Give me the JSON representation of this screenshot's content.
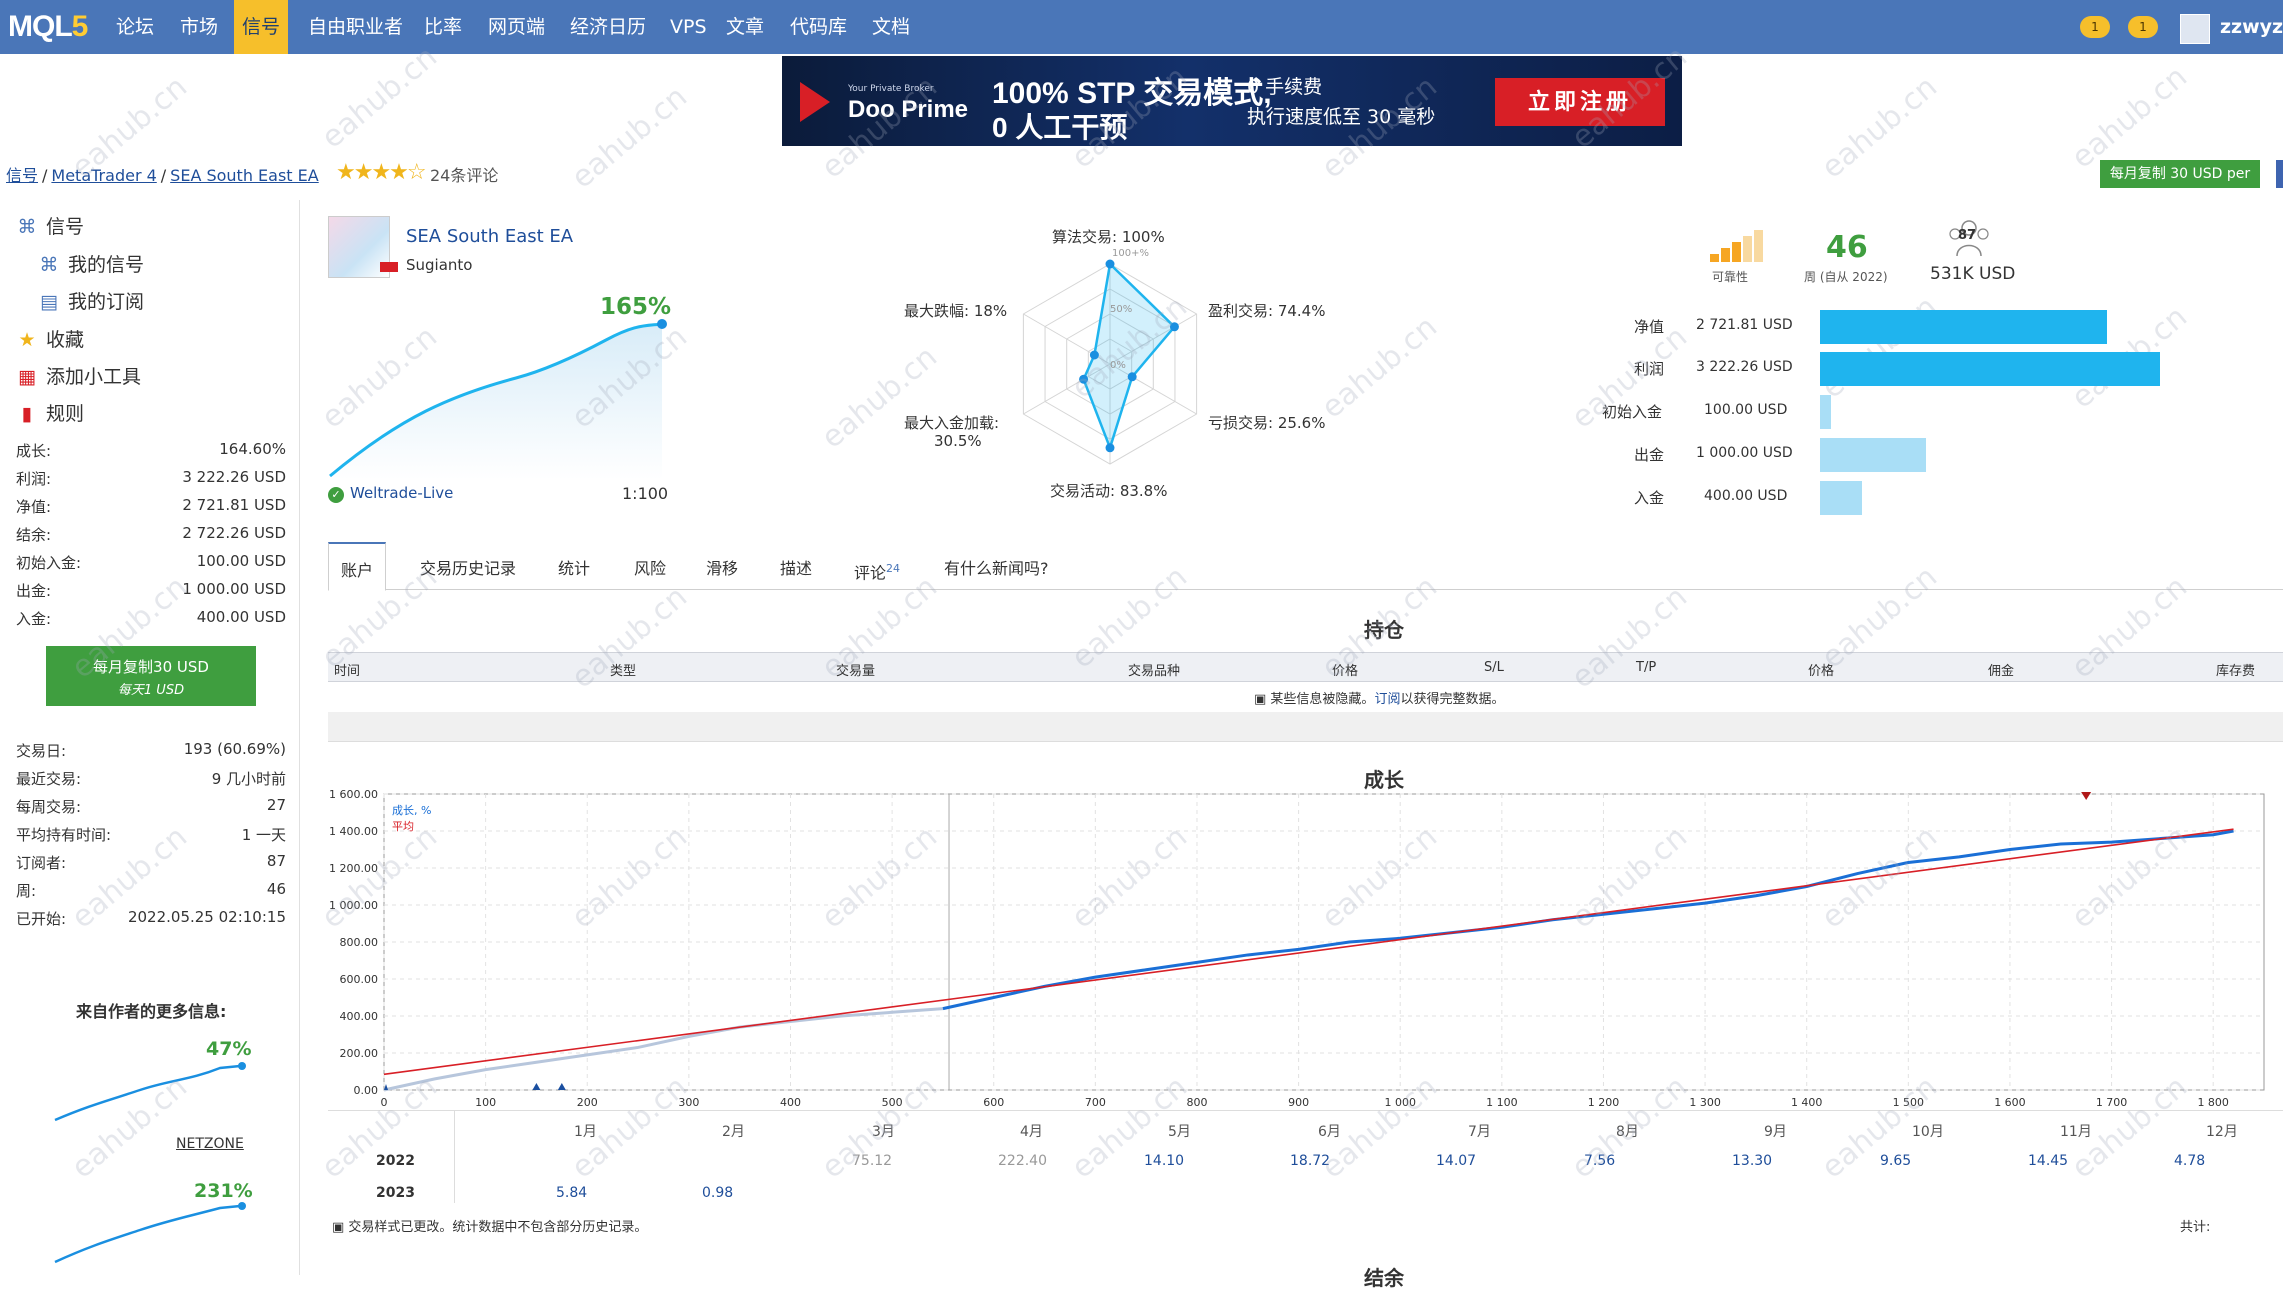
{
  "nav": {
    "logo": "MQL5",
    "items": [
      "论坛",
      "市场",
      "信号",
      "自由职业者",
      "比率",
      "网页端",
      "经济日历",
      "VPS",
      "文章",
      "代码库",
      "文档"
    ],
    "active": "信号",
    "username": "zzwyzw",
    "notif1": "1",
    "notif2": "1"
  },
  "banner": {
    "small": "Your Private Broker",
    "brand": "Doo Prime",
    "headline1": "100% STP 交易模式,",
    "headline2": "0 人工干预",
    "feature1": "0 手续费",
    "feature2": "执行速度低至 30 毫秒",
    "cta": "立即注册"
  },
  "breadcrumb": {
    "signals": "信号",
    "platform": "MetaTrader 4",
    "name": "SEA South East EA",
    "reviews": "24条评论"
  },
  "copy_top": "每月复制 30 USD per",
  "sidebar": {
    "menu": [
      "信号",
      "我的信号",
      "我的订阅",
      "收藏",
      "添加小工具",
      "规则"
    ],
    "stats": [
      {
        "k": "成长:",
        "v": "164.60%"
      },
      {
        "k": "利润:",
        "v": "3 222.26 USD"
      },
      {
        "k": "净值:",
        "v": "2 721.81 USD"
      },
      {
        "k": "结余:",
        "v": "2 722.26 USD"
      },
      {
        "k": "初始入金:",
        "v": "100.00 USD"
      },
      {
        "k": "出金:",
        "v": "1 000.00 USD"
      },
      {
        "k": "入金:",
        "v": "400.00 USD"
      }
    ],
    "copy_btn": "每月复制30 USD",
    "copy_btn_sub": "每天1 USD",
    "stats2": [
      {
        "k": "交易日:",
        "v": "193 (60.69%)"
      },
      {
        "k": "最近交易:",
        "v": "9 几小时前"
      },
      {
        "k": "每周交易:",
        "v": "27"
      },
      {
        "k": "平均持有时间:",
        "v": "1 一天"
      },
      {
        "k": "订阅者:",
        "v": "87"
      },
      {
        "k": "周:",
        "v": "46"
      },
      {
        "k": "已开始:",
        "v": "2022.05.25 02:10:15"
      }
    ],
    "more_info": "来自作者的更多信息:",
    "mini": [
      {
        "pct": "47%",
        "name": "NETZONE"
      },
      {
        "pct": "231%",
        "name": ""
      }
    ]
  },
  "signal": {
    "name": "SEA South East EA",
    "author": "Sugianto",
    "growth": "165%",
    "broker": "Weltrade-Live",
    "leverage": "1:100"
  },
  "radar": {
    "labels": {
      "top": "算法交易: 100%",
      "right_top": "盈利交易: 74.4%",
      "right_bottom": "亏损交易: 25.6%",
      "bottom": "交易活动: 83.8%",
      "left_bottom": "最大入金加载:",
      "left_bottom2": "30.5%",
      "left_top": "最大跌幅: 18%"
    },
    "ring_labels": [
      "100+%",
      "50%",
      "0%"
    ],
    "values": [
      1.0,
      0.744,
      0.256,
      0.838,
      0.305,
      0.18
    ]
  },
  "summary": {
    "reliability": "可靠性",
    "weeks": "46",
    "weeks_label": "周 (自从 2022)",
    "subs": "87",
    "funds": "531K USD"
  },
  "bars": [
    {
      "k": "净值",
      "v": "2 721.81 USD",
      "value": 2721.81,
      "color": "#1fb4ee"
    },
    {
      "k": "利润",
      "v": "3 222.26 USD",
      "value": 3222.26,
      "color": "#1fb4ee"
    },
    {
      "k": "初始入金",
      "v": "100.00 USD",
      "value": 100,
      "color": "#a9def6"
    },
    {
      "k": "出金",
      "v": "1 000.00 USD",
      "value": 1000,
      "color": "#a9def6"
    },
    {
      "k": "入金",
      "v": "400.00 USD",
      "value": 400,
      "color": "#a9def6"
    }
  ],
  "tabs": [
    "账户",
    "交易历史记录",
    "统计",
    "风险",
    "滑移",
    "描述",
    "评论",
    "有什么新闻吗?"
  ],
  "tab_badge": "24",
  "positions": {
    "title": "持仓",
    "headers": [
      "时间",
      "类型",
      "交易量",
      "交易品种",
      "价格",
      "S/L",
      "T/P",
      "价格",
      "佣金",
      "库存费"
    ],
    "note": "某些信息被隐藏。",
    "note_link": "订阅",
    "note_tail": "以获得完整数据。"
  },
  "growth": {
    "title": "成长",
    "legend_growth": "成长, %",
    "legend_avg": "平均"
  },
  "chart_data": {
    "type": "line",
    "title": "成长",
    "xlabel": "",
    "ylabel": "",
    "xlim": [
      0,
      1850
    ],
    "ylim": [
      0,
      1600
    ],
    "x_ticks": [
      0,
      100,
      200,
      300,
      400,
      500,
      600,
      700,
      800,
      900,
      1000,
      1100,
      1200,
      1300,
      1400,
      1500,
      1600,
      1700,
      1800
    ],
    "y_ticks": [
      "0.00",
      "200.00",
      "400.00",
      "600.00",
      "800.00",
      "1 000.00",
      "1 200.00",
      "1 400.00",
      "1 600.00"
    ],
    "series": [
      {
        "name": "成长, %",
        "x": [
          0,
          50,
          100,
          150,
          200,
          250,
          300,
          350,
          400,
          450,
          500,
          550,
          600,
          650,
          700,
          750,
          800,
          850,
          900,
          950,
          1000,
          1050,
          1100,
          1150,
          1200,
          1250,
          1300,
          1350,
          1400,
          1450,
          1500,
          1550,
          1600,
          1650,
          1700,
          1750,
          1800,
          1820
        ],
        "y": [
          0,
          60,
          110,
          150,
          190,
          230,
          290,
          340,
          370,
          400,
          420,
          440,
          500,
          560,
          610,
          650,
          690,
          730,
          760,
          800,
          820,
          850,
          880,
          920,
          950,
          980,
          1010,
          1050,
          1100,
          1170,
          1230,
          1260,
          1300,
          1330,
          1340,
          1360,
          1380,
          1400
        ]
      },
      {
        "name": "平均",
        "x": [
          0,
          1820
        ],
        "y": [
          85,
          1410
        ]
      }
    ],
    "grid": true
  },
  "year_table": {
    "months": [
      "1月",
      "2月",
      "3月",
      "4月",
      "5月",
      "6月",
      "7月",
      "8月",
      "9月",
      "10月",
      "11月",
      "12月"
    ],
    "rows": [
      {
        "year": "2022",
        "values": [
          "",
          "",
          "75.12",
          "222.40",
          "14.10",
          "18.72",
          "14.07",
          "7.56",
          "13.30",
          "9.65",
          "14.45",
          "4.78"
        ]
      },
      {
        "year": "2023",
        "values": [
          "5.84",
          "0.98",
          "",
          "",
          "",
          "",
          "",
          "",
          "",
          "",
          "",
          ""
        ]
      }
    ]
  },
  "foot_note": "交易样式已更改。统计数据中不包含部分历史记录。",
  "total_label": "共计:",
  "next_title": "结余",
  "watermark": "eahub.cn"
}
